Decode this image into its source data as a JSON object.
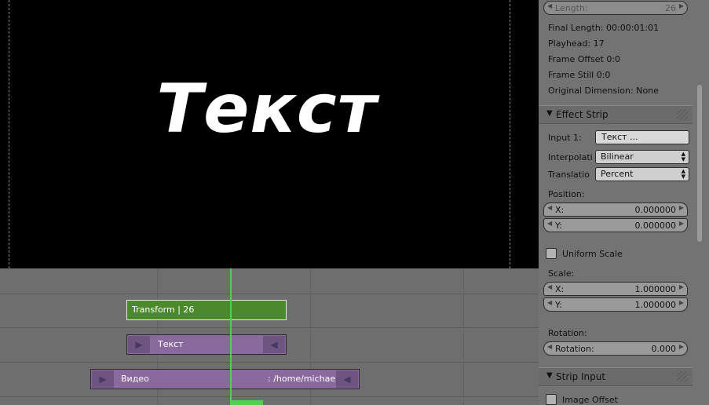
{
  "preview": {
    "text": "Текст"
  },
  "timeline": {
    "strips": [
      {
        "id": "transform",
        "label": "Transform | 26"
      },
      {
        "id": "text",
        "label": "Текст"
      },
      {
        "id": "video",
        "label": "Видео",
        "path": ": /home/michael"
      }
    ]
  },
  "panel": {
    "length": {
      "label": "Length:",
      "value": "26"
    },
    "info": {
      "final_length": "Final Length: 00:00:01:01",
      "playhead": "Playhead: 17",
      "frame_offset": "Frame Offset 0:0",
      "frame_still": "Frame Still 0:0",
      "original_dimension": "Original Dimension: None"
    },
    "effect_strip": {
      "title": "Effect Strip",
      "input1_label": "Input 1:",
      "input1_value": "Текст     ...",
      "interpolation_label": "Interpolati",
      "interpolation_value": "Bilinear",
      "translation_label": "Translatio",
      "translation_value": "Percent",
      "position_label": "Position:",
      "pos_x_label": "X:",
      "pos_x_value": "0.000000",
      "pos_y_label": "Y:",
      "pos_y_value": "0.000000",
      "uniform_scale_label": "Uniform Scale",
      "scale_label": "Scale:",
      "scale_x_label": "X:",
      "scale_x_value": "1.000000",
      "scale_y_label": "Y:",
      "scale_y_value": "1.000000",
      "rotation_section_label": "Rotation:",
      "rotation_label": "Rotation:",
      "rotation_value": "0.000"
    },
    "strip_input": {
      "title": "Strip Input",
      "image_offset_label": "Image Offset"
    }
  }
}
